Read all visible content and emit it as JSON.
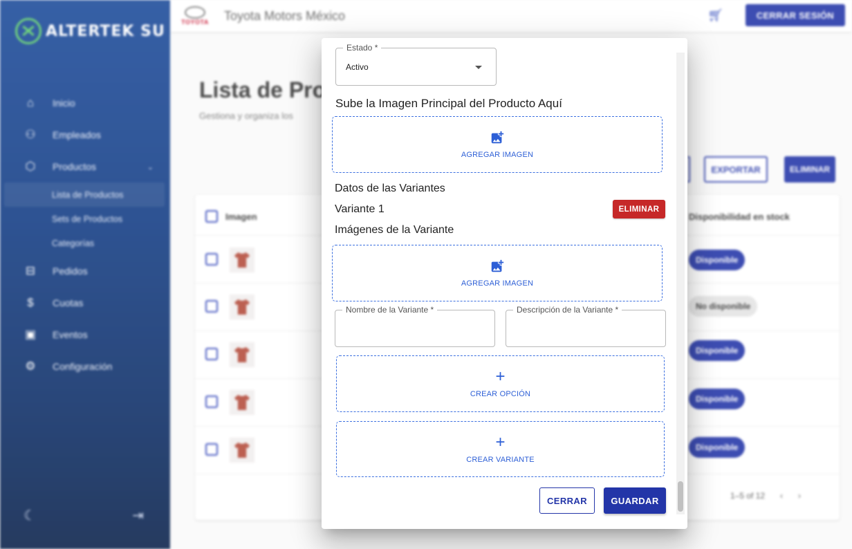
{
  "colors": {
    "primary": "#2335a8",
    "danger": "#c62828",
    "link": "#2d5fd6",
    "sidebar": "#123c84"
  },
  "sidebar": {
    "logo_text": "ALTERTEK SU",
    "items": [
      {
        "label": "Inicio",
        "icon": "home-icon"
      },
      {
        "label": "Empleados",
        "icon": "group-icon"
      },
      {
        "label": "Productos",
        "icon": "cube-icon"
      },
      {
        "label": "Pedidos",
        "icon": "inbox-icon"
      },
      {
        "label": "Cuotas",
        "icon": "money-icon"
      },
      {
        "label": "Eventos",
        "icon": "calendar-icon"
      },
      {
        "label": "Configuración",
        "icon": "gear-icon"
      }
    ],
    "subitems": [
      {
        "label": "Lista de Productos",
        "active": true
      },
      {
        "label": "Sets de Productos"
      },
      {
        "label": "Categorías"
      }
    ]
  },
  "topbar": {
    "brand_word": "TOYOTA",
    "company": "Toyota Motors México",
    "logout_label": "CERRAR SESIÓN"
  },
  "page": {
    "title": "Lista de Pro",
    "subtitle": "Gestiona y organiza los",
    "export_label": "EXPORTAR",
    "delete_label": "ELIMINAR"
  },
  "table": {
    "headers": {
      "image": "Imagen",
      "stock": "Disponibilidad en stock"
    },
    "rows": [
      {
        "stock": "Disponible",
        "available": true
      },
      {
        "stock": "No disponible",
        "available": false
      },
      {
        "stock": "Disponible",
        "available": true
      },
      {
        "stock": "Disponible",
        "available": true
      },
      {
        "stock": "Disponible",
        "available": true
      }
    ],
    "pagination": "1–5 of 12"
  },
  "dialog": {
    "estado_label": "Estado *",
    "estado_value": "Activo",
    "main_image_heading": "Sube la Imagen Principal del Producto Aquí",
    "add_image_label": "AGREGAR IMAGEN",
    "variants_heading": "Datos de las Variantes",
    "variant_title": "Variante 1",
    "eliminar_label": "ELIMINAR",
    "variant_images_heading": "Imágenes de la Variante",
    "variant_add_image_label": "AGREGAR IMAGEN",
    "variant_name_label": "Nombre de la Variante *",
    "variant_desc_label": "Descripción de la Variante *",
    "create_option_label": "CREAR OPCIÓN",
    "create_variant_label": "CREAR VARIANTE",
    "cerrar_label": "CERRAR",
    "guardar_label": "GUARDAR"
  }
}
